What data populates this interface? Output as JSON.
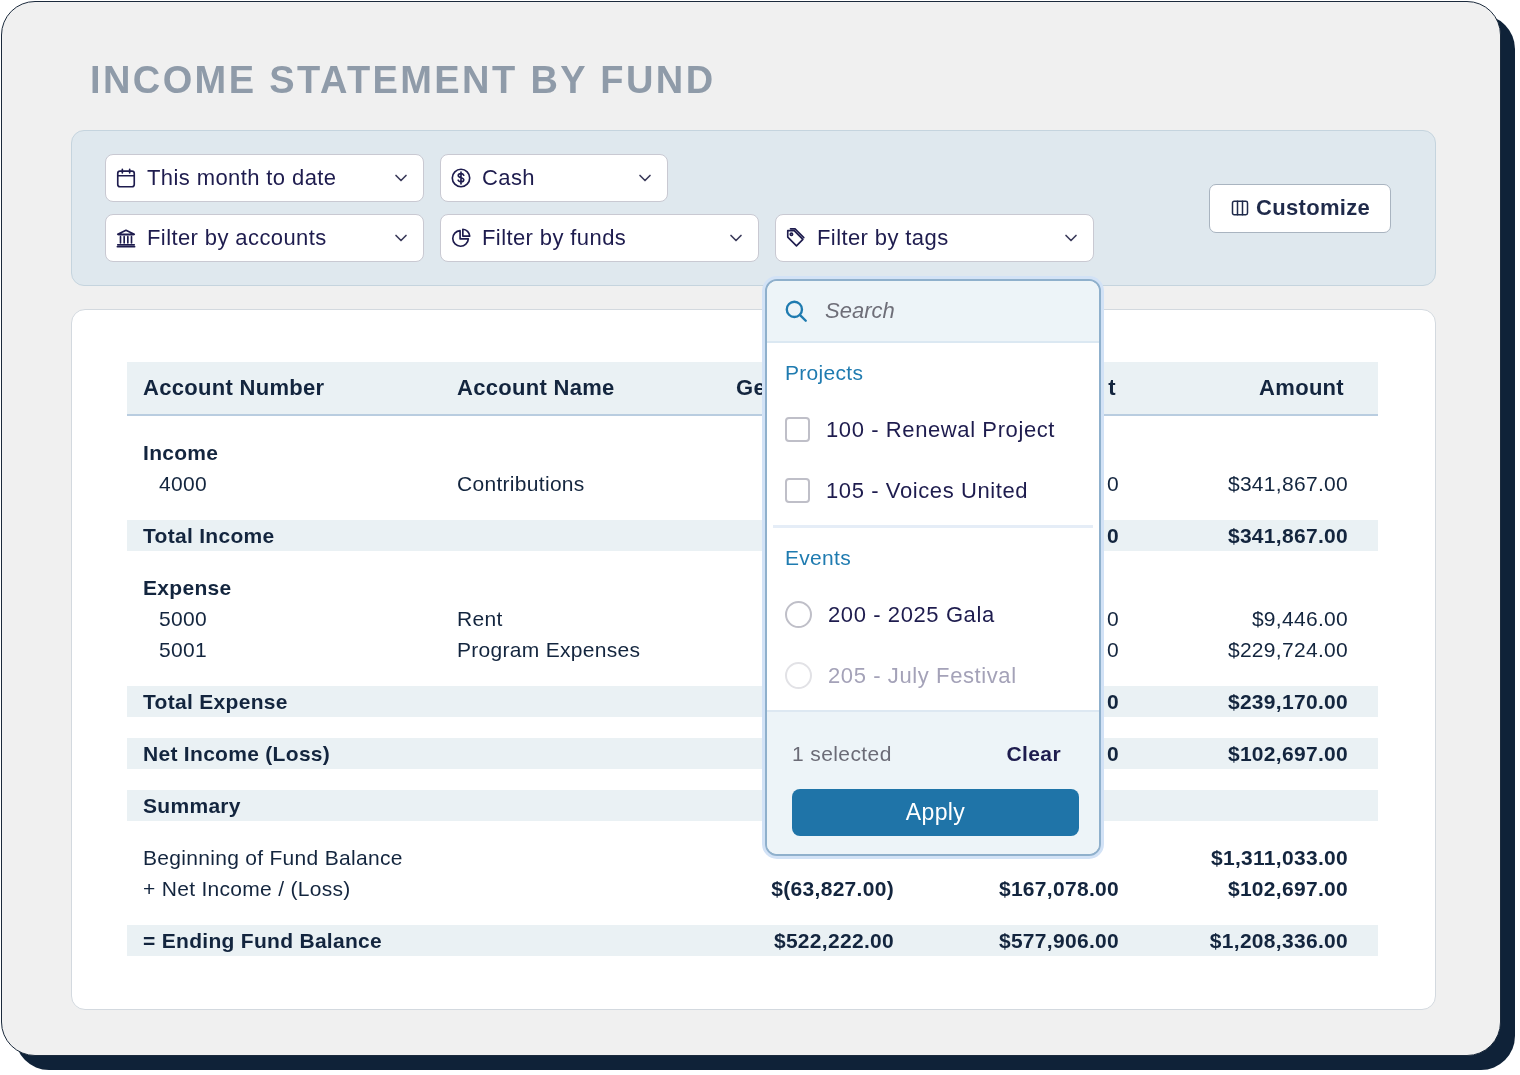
{
  "title": "INCOME STATEMENT BY FUND",
  "filters": [
    {
      "label": "This month to date"
    },
    {
      "label": "Cash"
    },
    {
      "label": "Filter by accounts"
    },
    {
      "label": "Filter by funds"
    },
    {
      "label": "Filter by tags"
    }
  ],
  "customize_button": "Customize",
  "table": {
    "columns": [
      {
        "label": "Account Number"
      },
      {
        "label": "Account Name"
      },
      {
        "label": "Ge"
      },
      {
        "label": "t"
      },
      {
        "label": "Amount"
      }
    ],
    "rows": [
      {
        "kind": "group",
        "label": "Income"
      },
      {
        "kind": "line",
        "number": "4000",
        "name": "Contributions",
        "column_4": "0",
        "amount": "$341,867.00"
      },
      {
        "kind": "total",
        "label": "Total Income",
        "column_4": "0",
        "amount": "$341,867.00"
      },
      {
        "kind": "group",
        "label": "Expense"
      },
      {
        "kind": "line",
        "number": "5000",
        "name": "Rent",
        "column_4": "0",
        "amount": "$9,446.00"
      },
      {
        "kind": "line",
        "number": "5001",
        "name": "Program Expenses",
        "column_4": "0",
        "amount": "$229,724.00"
      },
      {
        "kind": "total",
        "label": "Total Expense",
        "column_4": "0",
        "amount": "$239,170.00"
      },
      {
        "kind": "total",
        "label": "Net Income (Loss)",
        "column_4": "0",
        "amount": "$102,697.00"
      },
      {
        "kind": "total",
        "label": "Summary"
      },
      {
        "kind": "summary_line",
        "label": "Beginning of Fund Balance",
        "amount": "$1,311,033.00"
      },
      {
        "kind": "summary_line",
        "label": "+ Net Income / (Loss)",
        "column_3": "$(63,827.00)",
        "column_4": "$167,078.00",
        "amount": "$102,697.00"
      },
      {
        "kind": "total",
        "label": "= Ending Fund Balance",
        "column_3": "$522,222.00",
        "column_4": "$577,906.00",
        "amount": "$1,208,336.00"
      }
    ]
  },
  "tag_menu": {
    "search": {
      "placeholder": "Search"
    },
    "sections": [
      {
        "heading": "Projects",
        "options": [
          {
            "kind": "checkbox",
            "label": "100 - Renewal Project",
            "checked": false,
            "disabled": false
          },
          {
            "kind": "checkbox",
            "label": "105 - Voices United",
            "checked": false,
            "disabled": false
          }
        ]
      },
      {
        "heading": "Events",
        "options": [
          {
            "kind": "radio",
            "label": "200 - 2025 Gala",
            "checked": false,
            "disabled": false
          },
          {
            "kind": "radio",
            "label": "205 - July Festival",
            "checked": false,
            "disabled": true
          }
        ]
      }
    ],
    "selected_count": "1 selected",
    "clear_button": "Clear",
    "apply_button": "Apply"
  }
}
